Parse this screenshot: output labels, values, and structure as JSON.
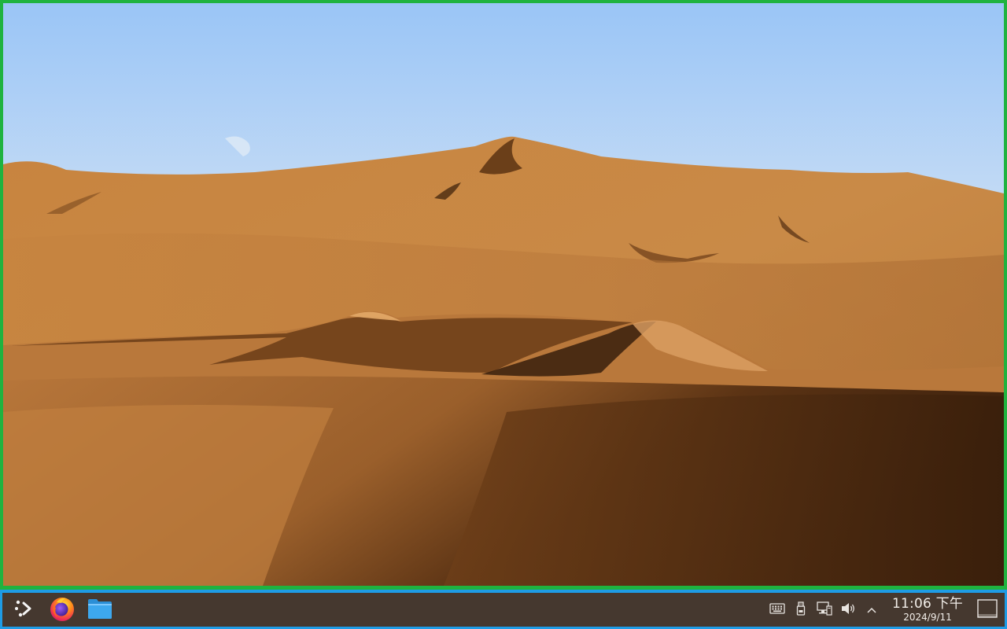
{
  "desktop": {
    "wallpaper": "desert-sand-dunes",
    "border_color": "#1fb33f"
  },
  "taskbar": {
    "border_color": "#1e9ce6",
    "background": "#45382f",
    "launcher_icon": "app-launcher-icon",
    "pinned_apps": [
      {
        "name": "Firefox",
        "icon": "firefox-icon"
      },
      {
        "name": "Files",
        "icon": "folder-icon"
      }
    ],
    "tray": {
      "icons": [
        "keyboard-icon",
        "usb-drive-icon",
        "network-icon",
        "volume-icon",
        "chevron-up-icon"
      ]
    },
    "clock": {
      "time": "11:06 下午",
      "date": "2024/9/11"
    },
    "show_desktop_icon": "show-desktop-icon"
  }
}
